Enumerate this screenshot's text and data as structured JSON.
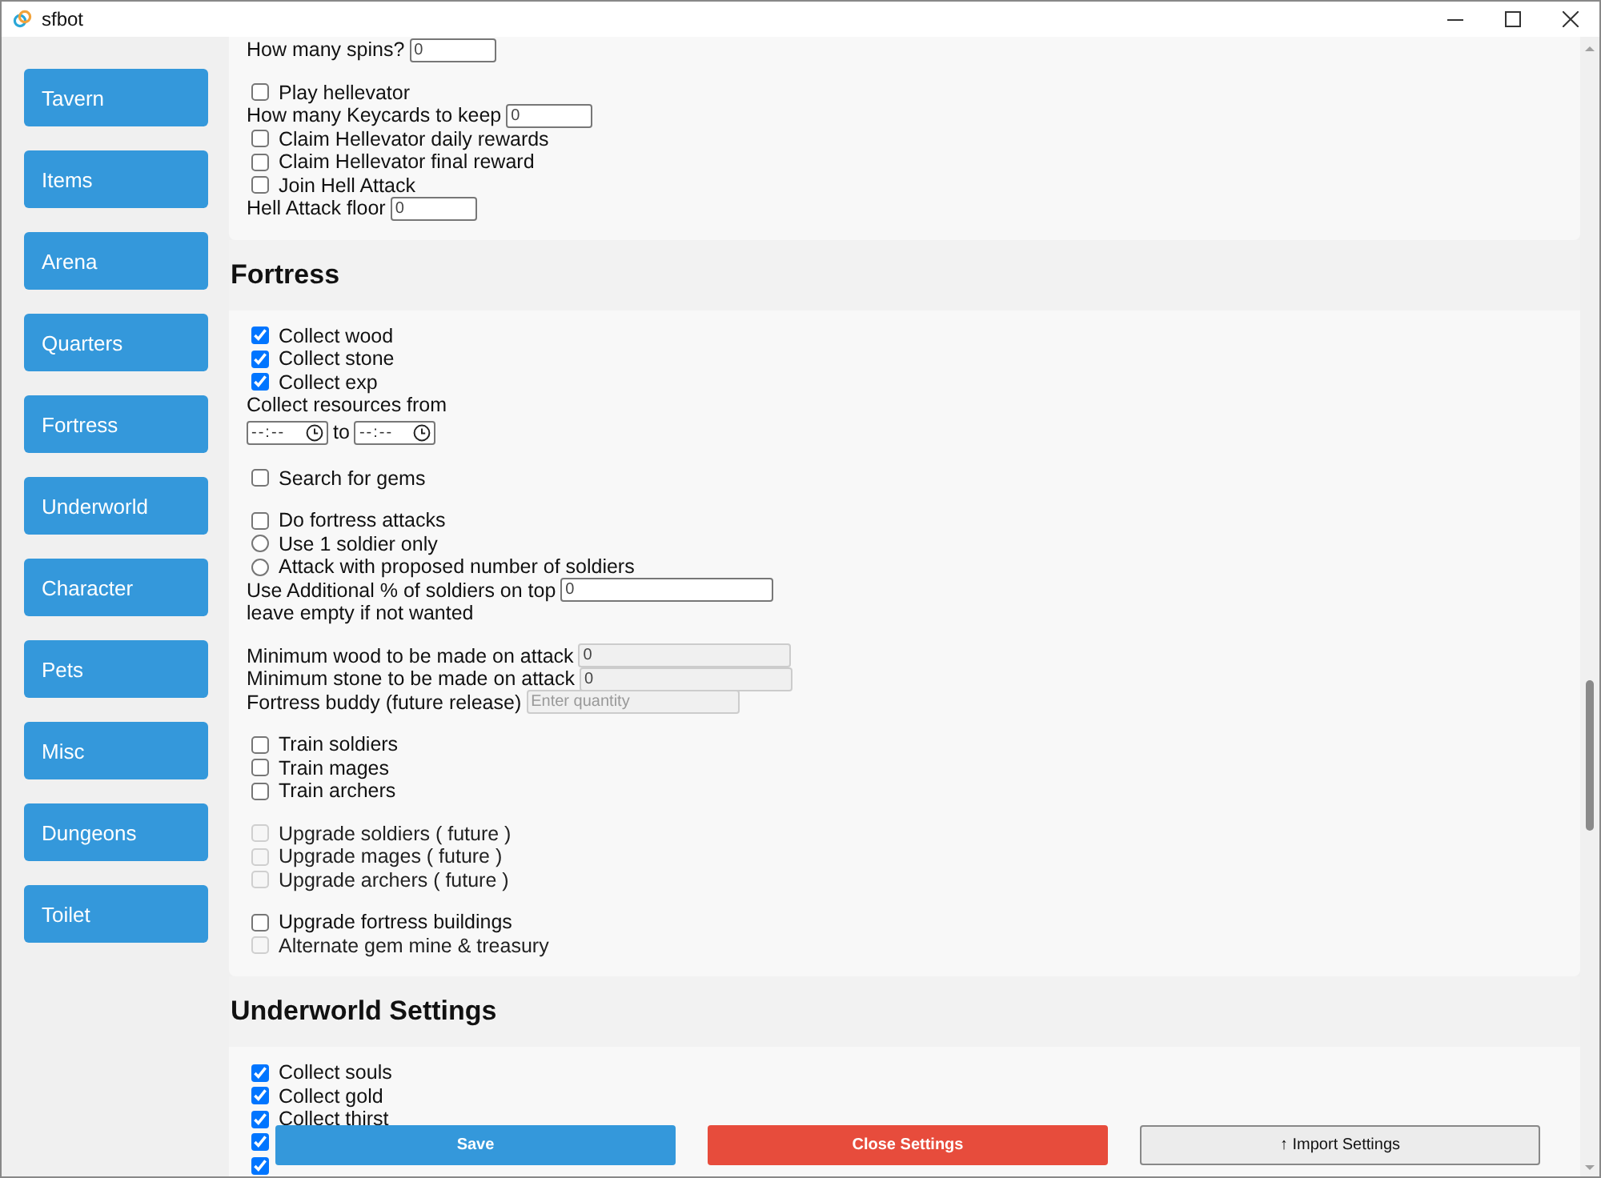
{
  "window": {
    "title": "sfbot"
  },
  "sidebar": {
    "items": [
      {
        "label": "Tavern"
      },
      {
        "label": "Items"
      },
      {
        "label": "Arena"
      },
      {
        "label": "Quarters"
      },
      {
        "label": "Fortress"
      },
      {
        "label": "Underworld"
      },
      {
        "label": "Character"
      },
      {
        "label": "Pets"
      },
      {
        "label": "Misc"
      },
      {
        "label": "Dungeons"
      },
      {
        "label": "Toilet"
      }
    ]
  },
  "sections": [
    {
      "items": [
        {
          "kind": "field",
          "label": "How many spins?",
          "value": "0"
        },
        {
          "kind": "gap"
        },
        {
          "kind": "checkbox",
          "label": "Play hellevator",
          "checked": false,
          "disabled": false
        },
        {
          "kind": "field",
          "label": "How many Keycards to keep",
          "value": "0"
        },
        {
          "kind": "checkbox",
          "label": "Claim Hellevator daily rewards",
          "checked": false,
          "disabled": false
        },
        {
          "kind": "checkbox",
          "label": "Claim Hellevator final reward",
          "checked": false,
          "disabled": false
        },
        {
          "kind": "checkbox",
          "label": "Join Hell Attack",
          "checked": false,
          "disabled": false
        },
        {
          "kind": "field",
          "label": "Hell Attack floor",
          "value": "0"
        }
      ]
    },
    {
      "title": "Fortress",
      "items": [
        {
          "kind": "checkbox",
          "label": "Collect wood",
          "checked": true,
          "disabled": false
        },
        {
          "kind": "checkbox",
          "label": "Collect stone",
          "checked": true,
          "disabled": false
        },
        {
          "kind": "checkbox",
          "label": "Collect exp",
          "checked": true,
          "disabled": false
        },
        {
          "kind": "text",
          "text": "Collect resources from"
        },
        {
          "kind": "time_range",
          "from": "--:--",
          "separator": "to",
          "to": "--:--"
        },
        {
          "kind": "gap"
        },
        {
          "kind": "checkbox",
          "label": "Search for gems",
          "checked": false,
          "disabled": false
        },
        {
          "kind": "gap"
        },
        {
          "kind": "checkbox",
          "label": "Do fortress attacks",
          "checked": false,
          "disabled": false
        },
        {
          "kind": "radio",
          "label": "Use 1 soldier only",
          "selected": false
        },
        {
          "kind": "radio",
          "label": "Attack with proposed number of soldiers",
          "selected": false
        },
        {
          "kind": "wide_field",
          "label": "Use Additional % of soldiers on top",
          "value": "0"
        },
        {
          "kind": "text",
          "text": "leave empty if not wanted"
        },
        {
          "kind": "gap"
        },
        {
          "kind": "wide_field",
          "label": "Minimum wood to be made on attack",
          "value": "0",
          "disabled": true
        },
        {
          "kind": "wide_field",
          "label": "Minimum stone to be made on attack",
          "value": "0",
          "disabled": true
        },
        {
          "kind": "wide_field",
          "label": "Fortress buddy (future release)",
          "placeholder": "Enter quantity",
          "disabled": true
        },
        {
          "kind": "gap"
        },
        {
          "kind": "checkbox",
          "label": "Train soldiers",
          "checked": false,
          "disabled": false
        },
        {
          "kind": "checkbox",
          "label": "Train mages",
          "checked": false,
          "disabled": false
        },
        {
          "kind": "checkbox",
          "label": "Train archers",
          "checked": false,
          "disabled": false
        },
        {
          "kind": "gap"
        },
        {
          "kind": "checkbox",
          "label": "Upgrade soldiers ( future )",
          "checked": false,
          "disabled": true
        },
        {
          "kind": "checkbox",
          "label": "Upgrade mages ( future )",
          "checked": false,
          "disabled": true
        },
        {
          "kind": "checkbox",
          "label": "Upgrade archers ( future )",
          "checked": false,
          "disabled": true
        },
        {
          "kind": "gap"
        },
        {
          "kind": "checkbox",
          "label": "Upgrade fortress buildings",
          "checked": false,
          "disabled": false
        },
        {
          "kind": "checkbox",
          "label": "Alternate gem mine & treasury",
          "checked": false,
          "disabled": true
        }
      ]
    },
    {
      "title": "Underworld Settings",
      "items": [
        {
          "kind": "checkbox",
          "label": "Collect souls",
          "checked": true,
          "disabled": false
        },
        {
          "kind": "checkbox",
          "label": "Collect gold",
          "checked": true,
          "disabled": false
        },
        {
          "kind": "checkbox",
          "label": "Collect thirst",
          "checked": true,
          "disabled": false
        },
        {
          "kind": "checkbox",
          "checked": true,
          "disabled": false
        },
        {
          "kind": "checkbox",
          "checked": true,
          "disabled": false
        }
      ]
    }
  ],
  "footer": {
    "buttons": [
      {
        "label": "Save",
        "kind": "primary"
      },
      {
        "label": "Close Settings",
        "kind": "danger"
      },
      {
        "label": "↑ Import Settings",
        "kind": "secondary"
      }
    ]
  }
}
